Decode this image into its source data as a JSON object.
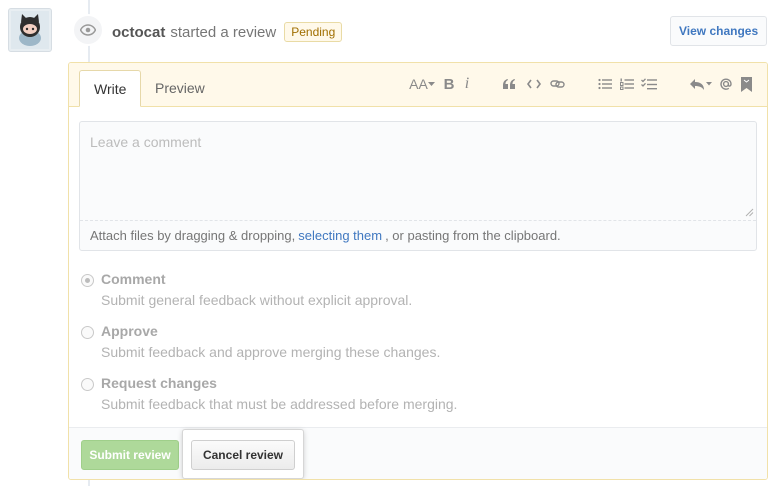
{
  "review": {
    "author": "octocat",
    "action": "started a review",
    "status_badge": "Pending",
    "view_changes_label": "View changes"
  },
  "editor": {
    "tabs": [
      {
        "label": "Write",
        "active": true
      },
      {
        "label": "Preview",
        "active": false
      }
    ],
    "toolbar": {
      "heading_label": "AA",
      "bold_label": "B",
      "italic_label": "i"
    },
    "comment_placeholder": "Leave a comment",
    "attach": {
      "prefix": "Attach files by dragging & dropping,",
      "link": "selecting them",
      "suffix": ", or pasting from the clipboard."
    }
  },
  "options": [
    {
      "title": "Comment",
      "description": "Submit general feedback without explicit approval.",
      "checked": true
    },
    {
      "title": "Approve",
      "description": "Submit feedback and approve merging these changes.",
      "checked": false
    },
    {
      "title": "Request changes",
      "description": "Submit feedback that must be addressed before merging.",
      "checked": false
    }
  ],
  "footer": {
    "submit_label": "Submit review",
    "cancel_label": "Cancel review"
  },
  "colors": {
    "accent_link": "#4078c0",
    "pending_badge_bg": "#fff9ea",
    "submit_green": "#aed99a"
  }
}
